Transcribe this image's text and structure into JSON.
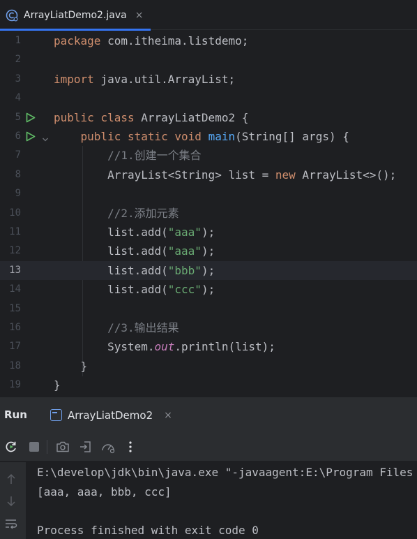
{
  "editor_tab": {
    "title": "ArrayLiatDemo2.java",
    "close": "×"
  },
  "code_lines": [
    {
      "num": "1",
      "tokens": [
        [
          "kw",
          "package"
        ],
        [
          "",
          "com.itheima.listdemo;"
        ]
      ]
    },
    {
      "num": "2",
      "tokens": []
    },
    {
      "num": "3",
      "tokens": [
        [
          "kw",
          "import"
        ],
        [
          "",
          "java.util.ArrayList;"
        ]
      ]
    },
    {
      "num": "4",
      "tokens": []
    },
    {
      "num": "5",
      "run": true,
      "tokens": [
        [
          "kw",
          "public class"
        ],
        [
          "",
          " ArrayLiatDemo2 {"
        ]
      ]
    },
    {
      "num": "6",
      "run": true,
      "fold": true,
      "tokens": [
        [
          "",
          "    "
        ],
        [
          "kw",
          "public static void"
        ],
        [
          "",
          " "
        ],
        [
          "fn",
          "main"
        ],
        [
          "",
          "(String[] args) {"
        ]
      ]
    },
    {
      "num": "7",
      "tokens": [
        [
          "",
          "        "
        ],
        [
          "cm",
          "//1.创建一个集合"
        ]
      ]
    },
    {
      "num": "8",
      "tokens": [
        [
          "",
          "        ArrayList<String> list = "
        ],
        [
          "kw",
          "new"
        ],
        [
          "",
          " ArrayList<>();"
        ]
      ]
    },
    {
      "num": "9",
      "tokens": []
    },
    {
      "num": "10",
      "tokens": [
        [
          "",
          "        "
        ],
        [
          "cm",
          "//2.添加元素"
        ]
      ]
    },
    {
      "num": "11",
      "tokens": [
        [
          "",
          "        list.add("
        ],
        [
          "str",
          "\"aaa\""
        ],
        [
          "",
          ");"
        ]
      ]
    },
    {
      "num": "12",
      "tokens": [
        [
          "",
          "        list.add("
        ],
        [
          "str",
          "\"aaa\""
        ],
        [
          "",
          ");"
        ]
      ]
    },
    {
      "num": "13",
      "current": true,
      "tokens": [
        [
          "",
          "        list.add("
        ],
        [
          "str",
          "\"bbb\""
        ],
        [
          "",
          ");"
        ]
      ]
    },
    {
      "num": "14",
      "tokens": [
        [
          "",
          "        list.add("
        ],
        [
          "str",
          "\"ccc\""
        ],
        [
          "",
          ");"
        ]
      ]
    },
    {
      "num": "15",
      "tokens": []
    },
    {
      "num": "16",
      "tokens": [
        [
          "",
          "        "
        ],
        [
          "cm",
          "//3.输出结果"
        ]
      ]
    },
    {
      "num": "17",
      "tokens": [
        [
          "",
          "        System."
        ],
        [
          "st",
          "out"
        ],
        [
          "",
          ".println(list);"
        ]
      ]
    },
    {
      "num": "18",
      "tokens": [
        [
          "",
          "    }"
        ]
      ]
    },
    {
      "num": "19",
      "tokens": [
        [
          "",
          "}"
        ]
      ]
    }
  ],
  "run_panel": {
    "label": "Run",
    "tab_title": "ArrayLiatDemo2",
    "tab_close": "×",
    "toolbar": [
      "rerun-icon",
      "stop-icon",
      "camera-icon",
      "restore-layout-icon",
      "performance-icon",
      "more-icon"
    ],
    "console_lines": [
      "E:\\develop\\jdk\\bin\\java.exe \"-javaagent:E:\\Program Files",
      "[aaa, aaa, bbb, ccc]",
      "",
      "Process finished with exit code 0"
    ]
  },
  "colors": {
    "background": "#1e1f22",
    "panel": "#2b2d30",
    "accent": "#3574f0",
    "keyword": "#cf8e6d",
    "string": "#6aab73",
    "comment": "#7a7e85",
    "run_green": "#5fb865"
  }
}
